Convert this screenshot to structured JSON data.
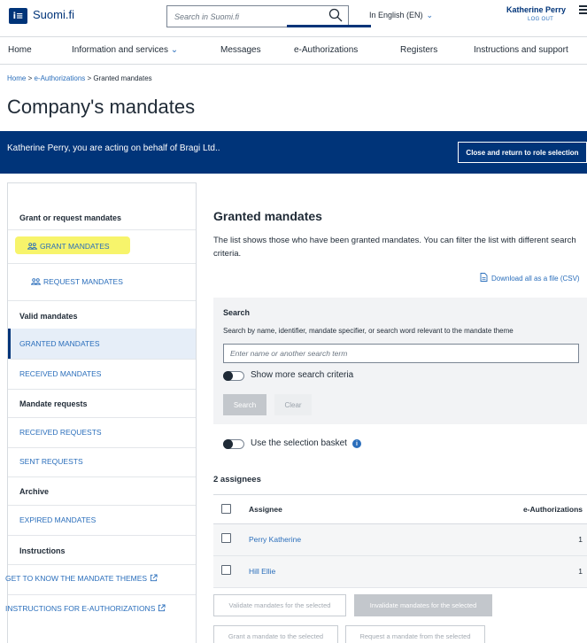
{
  "header": {
    "logo_mark": "i≡",
    "logo_text": "Suomi.fi",
    "search_placeholder": "Search in Suomi.fi",
    "language": "In English (EN)",
    "user_name": "Katherine Perry",
    "logout": "LOG OUT"
  },
  "nav": {
    "items": [
      {
        "label": "Home"
      },
      {
        "label": "Information and services"
      },
      {
        "label": "Messages"
      },
      {
        "label": "e-Authorizations"
      },
      {
        "label": "Registers"
      },
      {
        "label": "Instructions and support"
      }
    ]
  },
  "breadcrumb": {
    "home": "Home",
    "sep1": " > ",
    "eauth": "e-Authorizations",
    "sep2": " > ",
    "current": "Granted mandates"
  },
  "page_title": "Company's mandates",
  "banner": {
    "text": "Katherine Perry, you are acting on behalf of Bragi Ltd..",
    "button": "Close and return to role selection"
  },
  "sidebar": {
    "grant_request_heading": "Grant or request mandates",
    "grant_mandates": "GRANT MANDATES",
    "request_mandates": "REQUEST MANDATES",
    "valid_heading": "Valid mandates",
    "granted": "GRANTED MANDATES",
    "received": "RECEIVED MANDATES",
    "requests_heading": "Mandate requests",
    "received_requests": "RECEIVED REQUESTS",
    "sent_requests": "SENT REQUESTS",
    "archive_heading": "Archive",
    "expired": "EXPIRED MANDATES",
    "instructions_heading": "Instructions",
    "themes_link": "GET TO KNOW THE MANDATE THEMES",
    "instructions_link": "INSTRUCTIONS FOR E-AUTHORIZATIONS"
  },
  "main": {
    "heading": "Granted mandates",
    "description": "The list shows those who have been granted mandates. You can filter the list with different search criteria.",
    "download": "Download all as a file (CSV)"
  },
  "search_panel": {
    "title": "Search",
    "description": "Search by name, identifier, mandate specifier, or search word relevant to the mandate theme",
    "placeholder": "Enter name or another search term",
    "more_criteria": "Show more search criteria",
    "search_button": "Search",
    "clear_button": "Clear"
  },
  "basket": {
    "label": "Use the selection basket",
    "info": "i"
  },
  "results": {
    "count_text": "2 assignees",
    "columns": {
      "assignee": "Assignee",
      "eauth": "e-Authorizations"
    },
    "rows": [
      {
        "name": "Perry Katherine",
        "count": "1"
      },
      {
        "name": "Hill Ellie",
        "count": "1"
      }
    ]
  },
  "actions": {
    "validate": "Validate mandates for the selected",
    "invalidate": "Invalidate mandates for the selected",
    "grant_selected": "Grant a mandate to the selected",
    "request_selected": "Request a mandate from the selected"
  },
  "colors": {
    "brand": "#003479",
    "link": "#2a6ebb",
    "highlight": "#f7f46b"
  }
}
